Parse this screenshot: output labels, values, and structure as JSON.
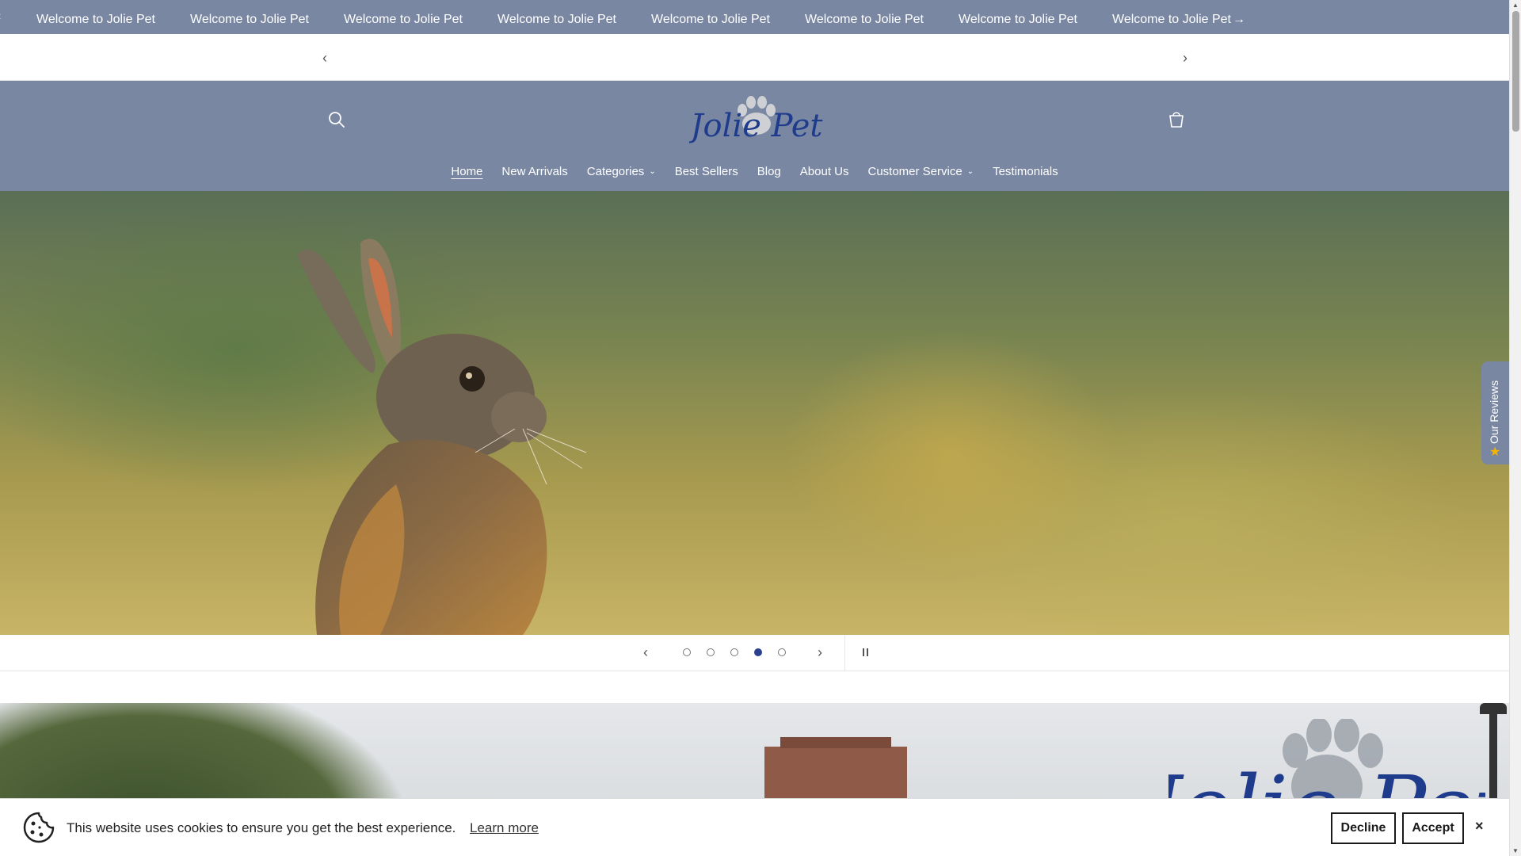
{
  "marquee": {
    "items": [
      "Welcome to Jolie Pet",
      "Welcome to Jolie Pet",
      "Welcome to Jolie Pet",
      "Welcome to Jolie Pet",
      "Welcome to Jolie Pet",
      "Welcome to Jolie Pet",
      "Welcome to Jolie Pet",
      "Welcome to Jolie Pet"
    ],
    "arrow_icon": "arrow-right-icon"
  },
  "header": {
    "logo_text": "Jolie Pet",
    "nav": [
      {
        "label": "Home",
        "active": true
      },
      {
        "label": "New Arrivals"
      },
      {
        "label": "Categories",
        "dropdown": true
      },
      {
        "label": "Best Sellers"
      },
      {
        "label": "Blog"
      },
      {
        "label": "About Us"
      },
      {
        "label": "Customer Service",
        "dropdown": true
      },
      {
        "label": "Testimonials"
      }
    ]
  },
  "slideshow": {
    "slide_count": 5,
    "active_slide": 4
  },
  "reviews_tab": {
    "label": "Our Reviews"
  },
  "cookie": {
    "message": "This website uses cookies to ensure you get the best experience.",
    "learn_more": "Learn more",
    "decline": "Decline",
    "accept": "Accept",
    "close": "×"
  },
  "colors": {
    "header_bg": "#7987a3",
    "logo_blue": "#1f3c8c",
    "active_dot": "#2b3f8f"
  }
}
